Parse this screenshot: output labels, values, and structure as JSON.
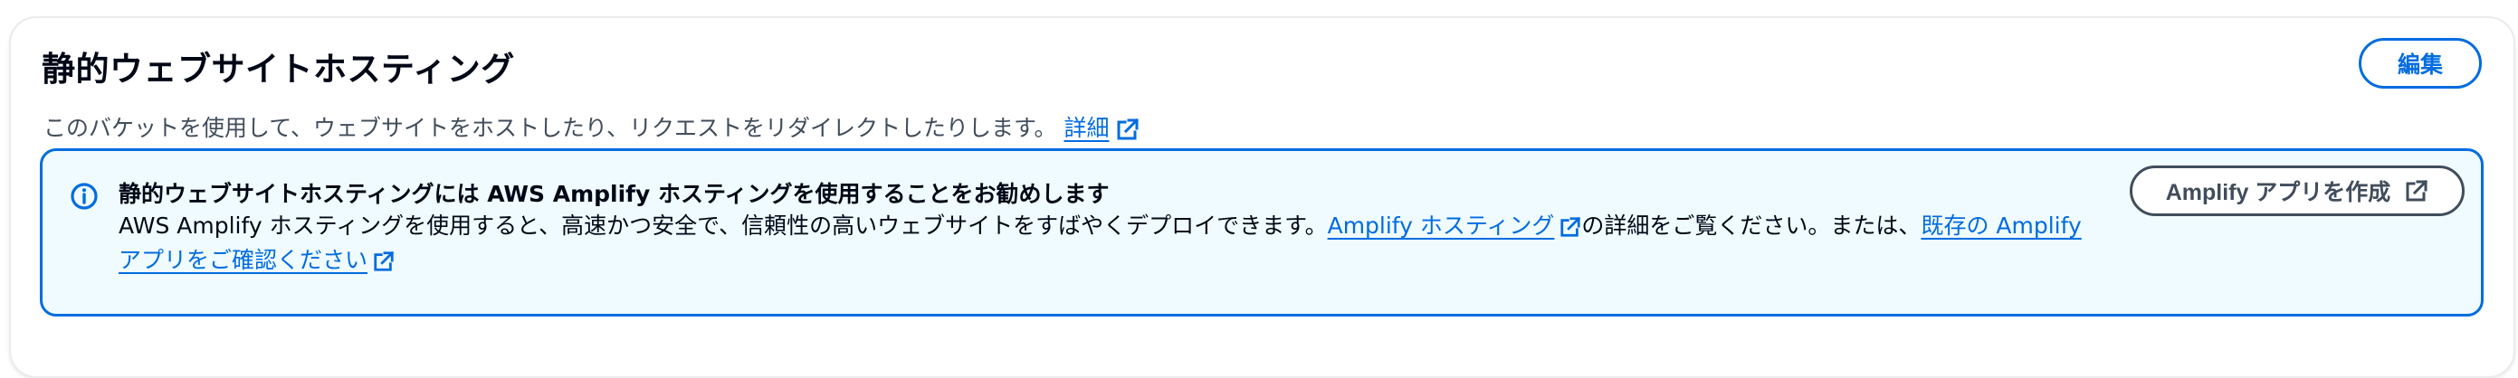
{
  "section": {
    "title": "静的ウェブサイトホスティング",
    "description": "このバケットを使用して、ウェブサイトをホストしたり、リクエストをリダイレクトしたりします。",
    "learn_more_link": "詳細",
    "edit_button": "編集"
  },
  "alert": {
    "title": "静的ウェブサイトホスティングには AWS Amplify ホスティングを使用することをお勧めします",
    "body_text_1": "AWS Amplify ホスティングを使用すると、高速かつ安全で、信頼性の高いウェブサイトをすばやくデプロイできます。",
    "amplify_hosting_link": "Amplify ホスティング",
    "body_text_2": "の詳細をご覧ください。または、",
    "existing_app_link_part1": "既存の Amplify",
    "existing_app_link_part2": "アプリをご確認ください",
    "create_app_button": "Amplify アプリを作成"
  },
  "colors": {
    "link": "#006ce0",
    "alert_border": "#006ce0",
    "alert_background": "#f0fbff",
    "text_primary": "#000716",
    "text_secondary": "#414d5c"
  },
  "icons": {
    "info": "info-icon",
    "external": "external-link-icon"
  }
}
